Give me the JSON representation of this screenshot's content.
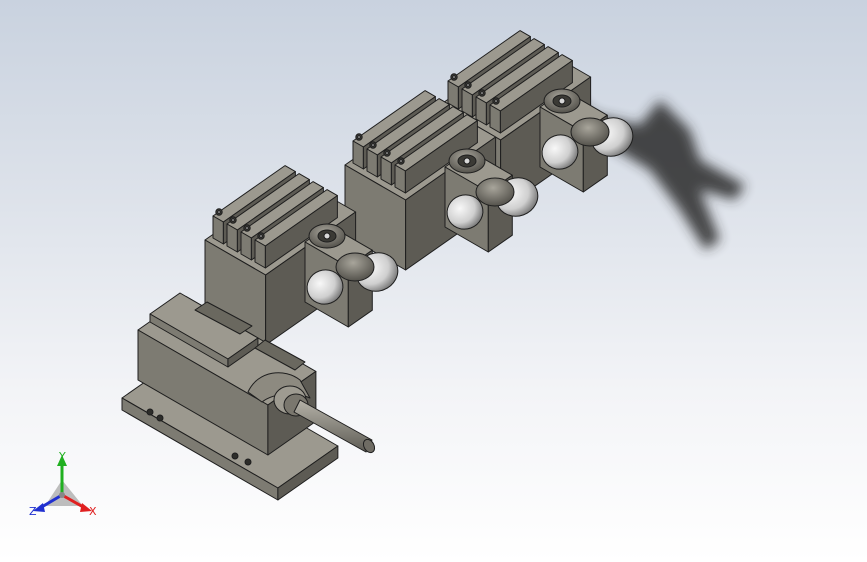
{
  "viewport": {
    "background_top": "#c9d2df",
    "background_bottom": "#ffffff"
  },
  "model": {
    "body_color": "#7d7b72",
    "body_light": "#9c998f",
    "body_dark": "#5d5b54",
    "edge_color": "#1e1e1e",
    "cap_color": "#8b8980",
    "cap_light": "#e6e6e6",
    "cable_color": "#8a877e"
  },
  "triad": {
    "x_label": "X",
    "y_label": "Y",
    "z_label": "Z",
    "x_color": "#e02020",
    "y_color": "#20b020",
    "z_color": "#2030d0"
  }
}
